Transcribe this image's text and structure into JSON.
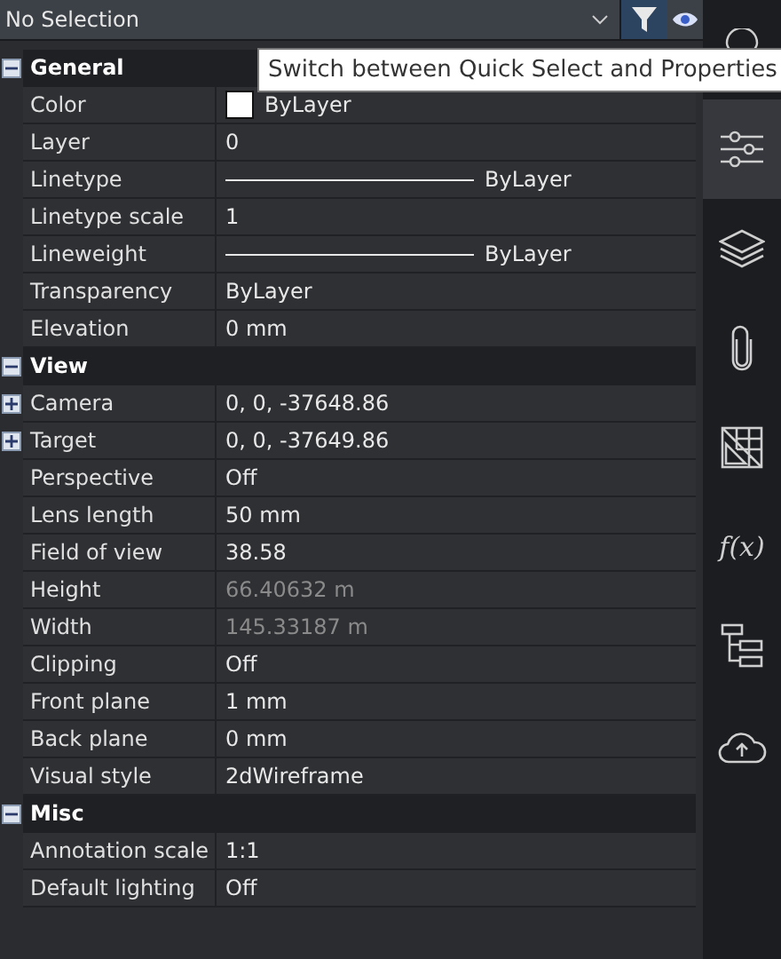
{
  "selector": {
    "value": "No Selection"
  },
  "tooltip": "Switch between Quick Select and Properties",
  "sections": [
    {
      "title": "General",
      "expanded": true,
      "rows": [
        {
          "label": "Color",
          "kind": "swatch",
          "value": "ByLayer"
        },
        {
          "label": "Layer",
          "kind": "text",
          "value": "0"
        },
        {
          "label": "Linetype",
          "kind": "line",
          "value": "ByLayer"
        },
        {
          "label": "Linetype scale",
          "kind": "text",
          "value": "1"
        },
        {
          "label": "Lineweight",
          "kind": "line",
          "value": "ByLayer"
        },
        {
          "label": "Transparency",
          "kind": "text",
          "value": "ByLayer"
        },
        {
          "label": "Elevation",
          "kind": "text",
          "value": "0 mm"
        }
      ]
    },
    {
      "title": "View",
      "expanded": true,
      "rows": [
        {
          "label": "Camera",
          "kind": "text",
          "value": "0, 0, -37648.86",
          "expanded": false
        },
        {
          "label": "Target",
          "kind": "text",
          "value": "0, 0, -37649.86",
          "expanded": false
        },
        {
          "label": "Perspective",
          "kind": "text",
          "value": "Off"
        },
        {
          "label": "Lens length",
          "kind": "text",
          "value": "50 mm"
        },
        {
          "label": "Field of view",
          "kind": "text",
          "value": "38.58"
        },
        {
          "label": "Height",
          "kind": "text",
          "value": "66.40632 m",
          "disabled": true
        },
        {
          "label": "Width",
          "kind": "text",
          "value": "145.33187 m",
          "disabled": true
        },
        {
          "label": "Clipping",
          "kind": "text",
          "value": "Off"
        },
        {
          "label": "Front plane",
          "kind": "text",
          "value": "1 mm"
        },
        {
          "label": "Back plane",
          "kind": "text",
          "value": "0 mm"
        },
        {
          "label": "Visual style",
          "kind": "text",
          "value": "2dWireframe"
        }
      ]
    },
    {
      "title": "Misc",
      "expanded": true,
      "rows": [
        {
          "label": "Annotation scale",
          "kind": "text",
          "value": "1:1"
        },
        {
          "label": "Default lighting",
          "kind": "text",
          "value": "Off"
        }
      ]
    }
  ],
  "sidebar": [
    {
      "kind": "bulb",
      "selected": false
    },
    {
      "kind": "sliders",
      "selected": true
    },
    {
      "kind": "layers",
      "selected": false
    },
    {
      "kind": "clip",
      "selected": false
    },
    {
      "kind": "grid",
      "selected": false
    },
    {
      "kind": "function",
      "label": "f(x)",
      "selected": false
    },
    {
      "kind": "tree",
      "selected": false
    },
    {
      "kind": "cloud",
      "selected": false
    }
  ]
}
